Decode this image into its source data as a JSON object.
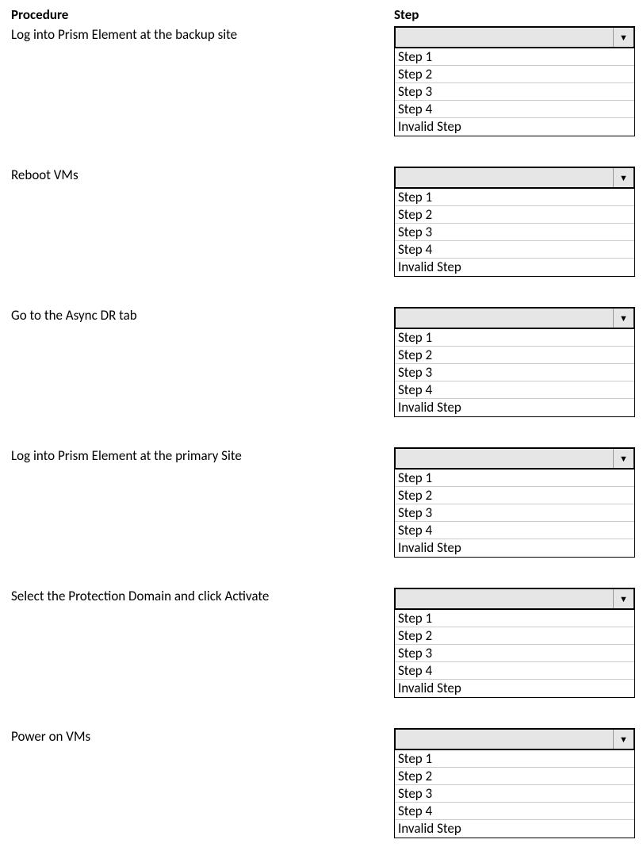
{
  "headers": {
    "procedure": "Procedure",
    "step": "Step"
  },
  "options": [
    "Step 1",
    "Step 2",
    "Step 3",
    "Step 4",
    "Invalid Step"
  ],
  "rows": [
    {
      "label": "Log into Prism Element at the backup site",
      "selected": ""
    },
    {
      "label": "Reboot VMs",
      "selected": ""
    },
    {
      "label": "Go to the Async DR tab",
      "selected": ""
    },
    {
      "label": "Log into Prism Element at the primary Site",
      "selected": ""
    },
    {
      "label": "Select the Protection Domain and click Activate",
      "selected": ""
    },
    {
      "label": "Power on VMs",
      "selected": ""
    }
  ]
}
